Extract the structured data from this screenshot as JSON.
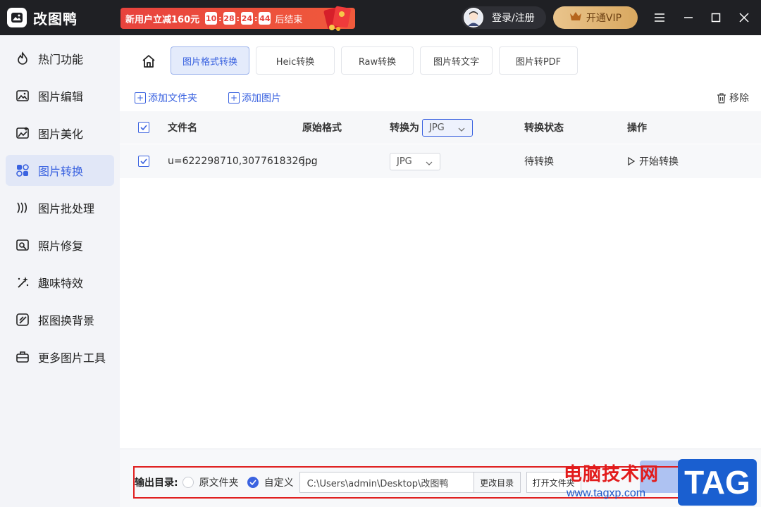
{
  "app": {
    "name": "改图鸭"
  },
  "promo": {
    "text": "新用户立减160元",
    "timer": [
      "10",
      "28",
      "24",
      "44"
    ],
    "end_text": "后结束"
  },
  "header": {
    "login_label": "登录/注册",
    "vip_label": "开通VIP"
  },
  "sidebar": {
    "items": [
      {
        "label": "热门功能",
        "icon": "fire-icon"
      },
      {
        "label": "图片编辑",
        "icon": "image-edit-icon"
      },
      {
        "label": "图片美化",
        "icon": "image-beautify-icon"
      },
      {
        "label": "图片转换",
        "icon": "image-convert-icon",
        "active": true
      },
      {
        "label": "图片批处理",
        "icon": "batch-icon"
      },
      {
        "label": "照片修复",
        "icon": "photo-repair-icon"
      },
      {
        "label": "趣味特效",
        "icon": "magic-wand-icon"
      },
      {
        "label": "抠图换背景",
        "icon": "cutout-icon"
      },
      {
        "label": "更多图片工具",
        "icon": "toolbox-icon"
      }
    ]
  },
  "tabs": [
    {
      "label": "图片格式转换",
      "active": true
    },
    {
      "label": "Heic转换"
    },
    {
      "label": "Raw转换"
    },
    {
      "label": "图片转文字"
    },
    {
      "label": "图片转PDF"
    }
  ],
  "toolbar": {
    "add_folder": "添加文件夹",
    "add_image": "添加图片",
    "remove": "移除"
  },
  "table": {
    "headers": {
      "filename": "文件名",
      "original_format": "原始格式",
      "convert_to": "转换为",
      "convert_to_value": "JPG",
      "status": "转换状态",
      "action": "操作"
    },
    "rows": [
      {
        "filename": "u=622298710,3077618326...",
        "original_format": "jpg",
        "target_format": "JPG",
        "status": "待转换",
        "action": "开始转换"
      }
    ]
  },
  "output": {
    "label": "输出目录:",
    "option_original": "原文件夹",
    "option_custom": "自定义",
    "selected": "custom",
    "path": "C:\\Users\\admin\\Desktop\\改图鸭",
    "change_dir": "更改目录",
    "open_folder": "打开文件夹"
  },
  "watermark": {
    "cn": "电脑技术网",
    "url": "www.tagxp.com",
    "tag": "TAG"
  },
  "colors": {
    "accent": "#3b63e0",
    "titlebar": "#1f2024",
    "promo": "#e8433d",
    "vip": "#d9a860",
    "highlight_box": "#e02020"
  }
}
